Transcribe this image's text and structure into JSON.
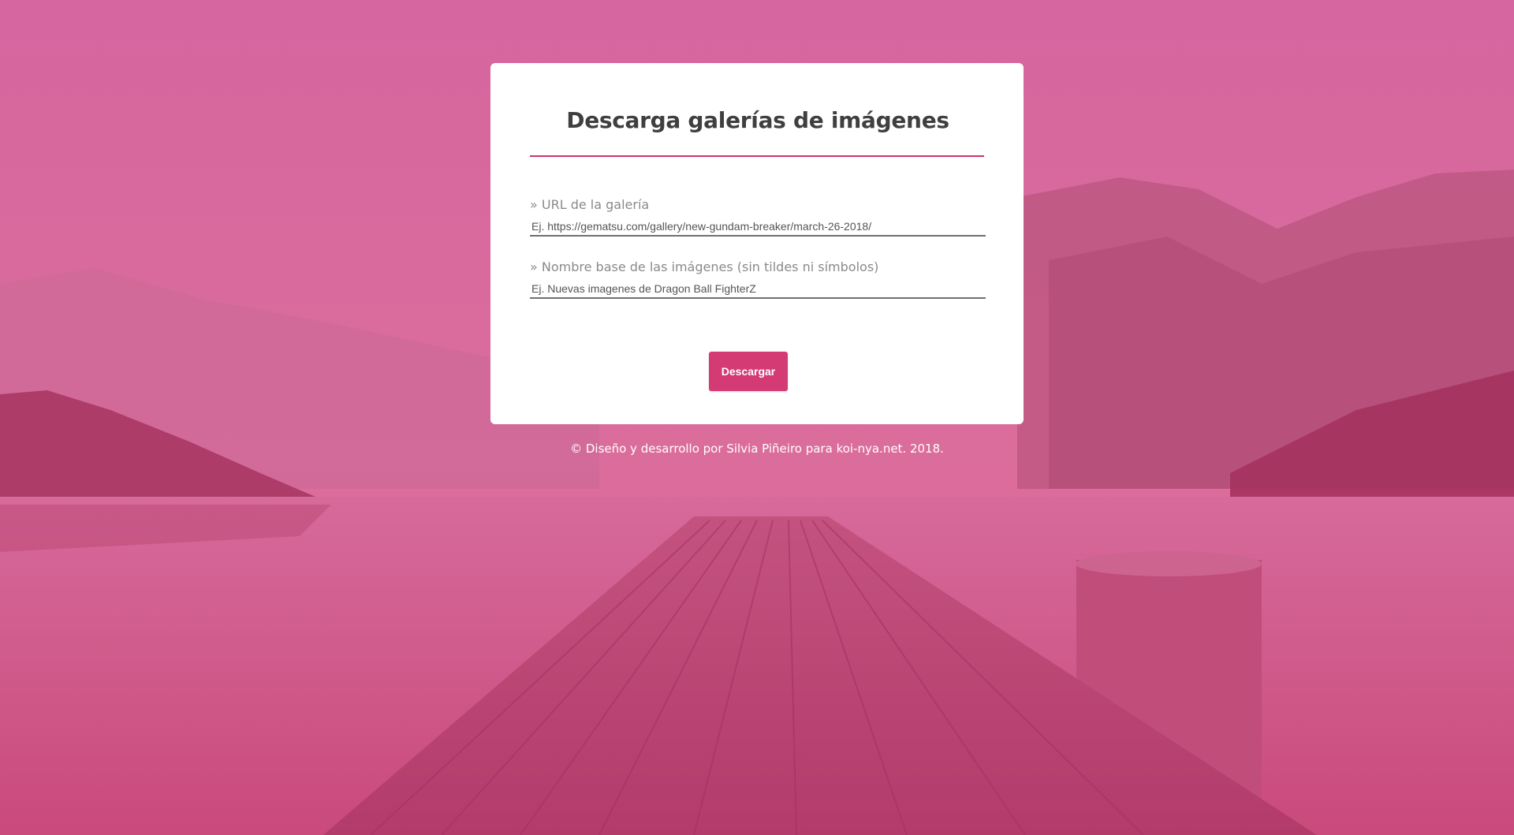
{
  "page": {
    "title": "Descarga galerías de imágenes",
    "accent_color": "#d43a74",
    "overlay_color": "#d6407a"
  },
  "form": {
    "url_label": "» URL de la galería",
    "url_placeholder": "Ej. https://gematsu.com/gallery/new-gundam-breaker/march-26-2018/",
    "url_value": "",
    "name_label": "» Nombre base de las imágenes (sin tildes ni símbolos)",
    "name_placeholder": "Ej. Nuevas imagenes de Dragon Ball FighterZ",
    "name_value": "",
    "submit_label": "Descargar"
  },
  "footer": {
    "text": "© Diseño y desarrollo por Silvia Piñeiro para koi-nya.net. 2018."
  }
}
